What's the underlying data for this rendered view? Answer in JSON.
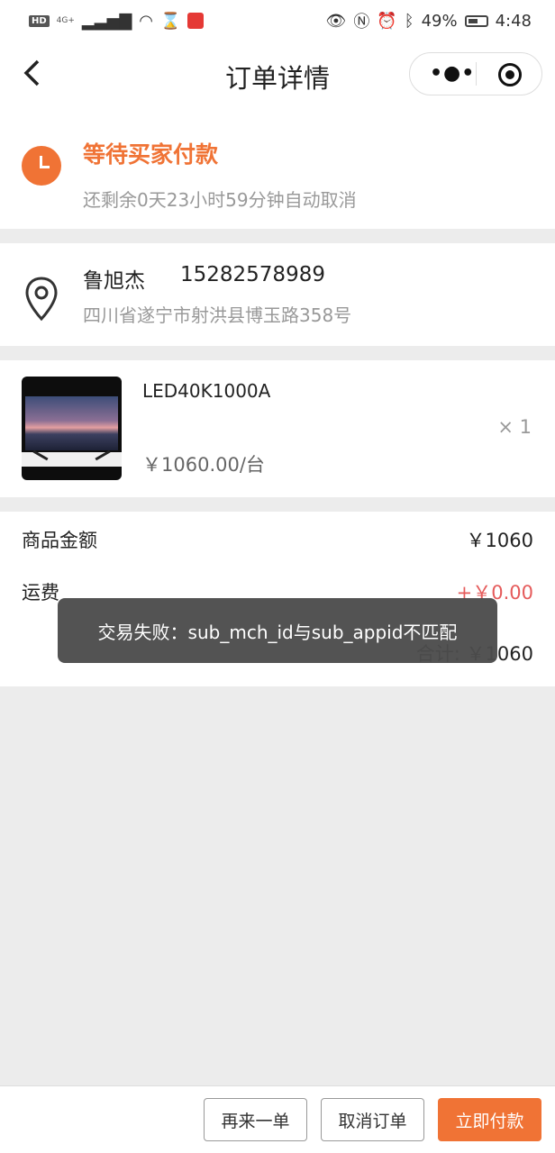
{
  "status_bar": {
    "hd": "HD",
    "signal": "4G+",
    "battery": "49%",
    "time": "4:48"
  },
  "nav": {
    "back_icon": "chevron-left-icon",
    "title": "订单详情",
    "menu_icon": "more-dots-icon",
    "close_icon": "target-icon"
  },
  "order_status": {
    "title": "等待买家付款",
    "countdown": "还剩余0天23小时59分钟自动取消",
    "accent_color": "#f07335"
  },
  "address": {
    "name": "鲁旭杰",
    "phone": "15282578989",
    "detail": "四川省遂宁市射洪县博玉路358号"
  },
  "product": {
    "name": "LED40K1000A",
    "price": "￥1060.00/台",
    "quantity": "× 1"
  },
  "summary": {
    "goods_label": "商品金额",
    "goods_value": "￥1060",
    "shipping_label": "运费",
    "shipping_value": "+￥0.00",
    "total": "合计: ￥1060"
  },
  "toast": {
    "message": "交易失败：sub_mch_id与sub_appid不匹配"
  },
  "actions": {
    "reorder": "再来一单",
    "cancel": "取消订单",
    "pay": "立即付款"
  }
}
